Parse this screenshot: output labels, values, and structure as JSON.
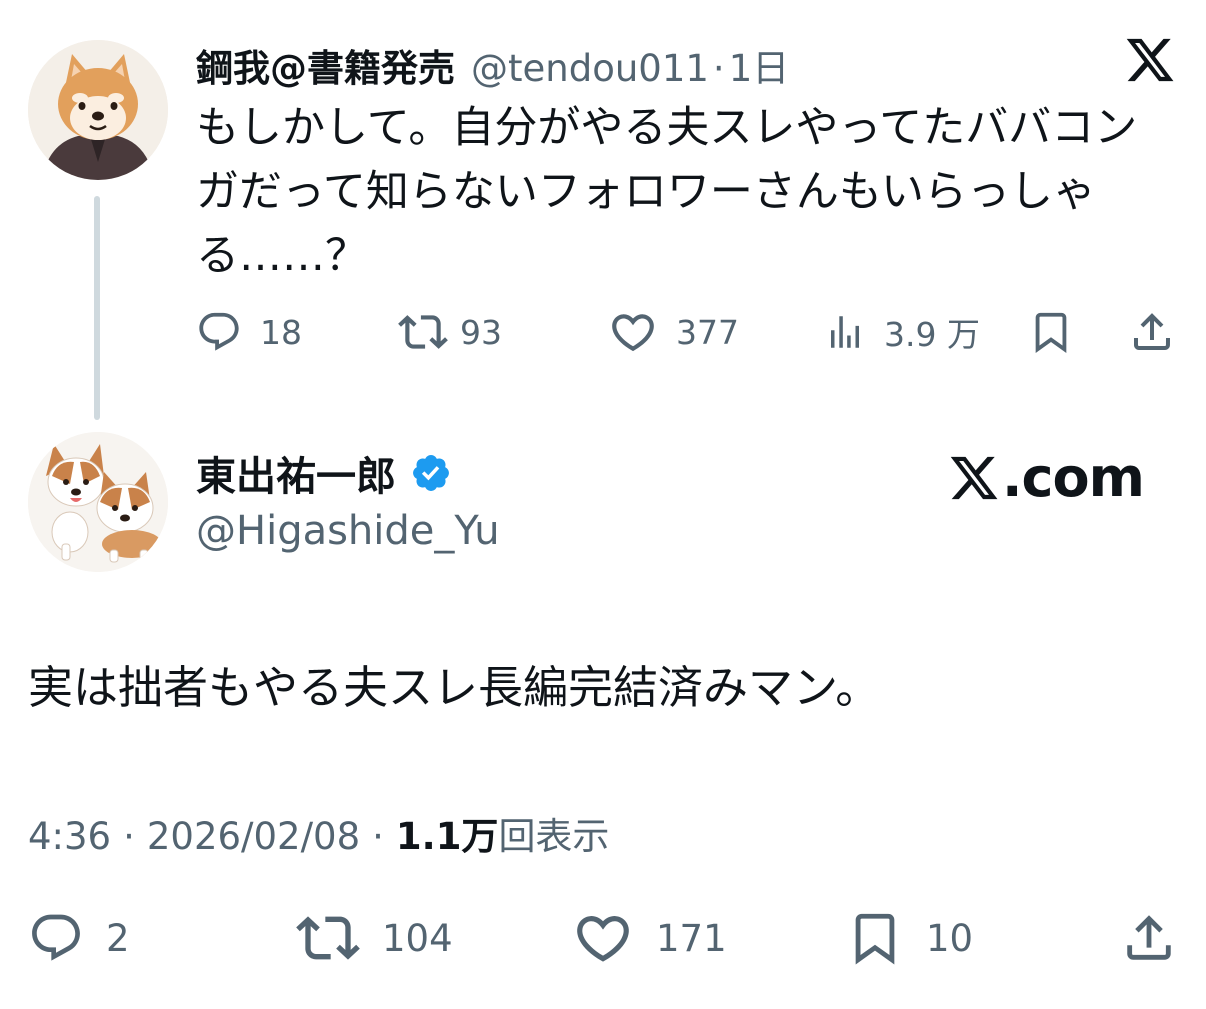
{
  "parent_tweet": {
    "display_name": "鋼我@書籍発売",
    "handle": "@tendou011",
    "separator": "·",
    "time": "1日",
    "text": "もしかして。自分がやる夫スレやってたババコンガだって知らないフォロワーさんもいらっしゃる……？",
    "avatar_icon": "shiba-dog-avatar",
    "actions": {
      "replies": "18",
      "reposts": "93",
      "likes": "377",
      "views": "3.9 万"
    }
  },
  "main_tweet": {
    "display_name": "東出祐一郎",
    "verified": true,
    "verified_color": "#1d9bf0",
    "handle": "@Higashide_Yu",
    "avatar_icon": "corgi-dogs-avatar",
    "text": "実は拙者もやる夫スレ長編完結済みマン。",
    "time": "4:36",
    "date": "2026/02/08",
    "views_count": "1.1万",
    "views_label": "回表示",
    "actions": {
      "replies": "2",
      "reposts": "104",
      "likes": "171",
      "bookmarks": "10"
    }
  },
  "branding": {
    "x_logo_icon": "x-logo-icon",
    "site_text": ".com"
  },
  "colors": {
    "text_primary": "#0f1419",
    "text_secondary": "#536471",
    "thread_line": "#cfd9de"
  }
}
